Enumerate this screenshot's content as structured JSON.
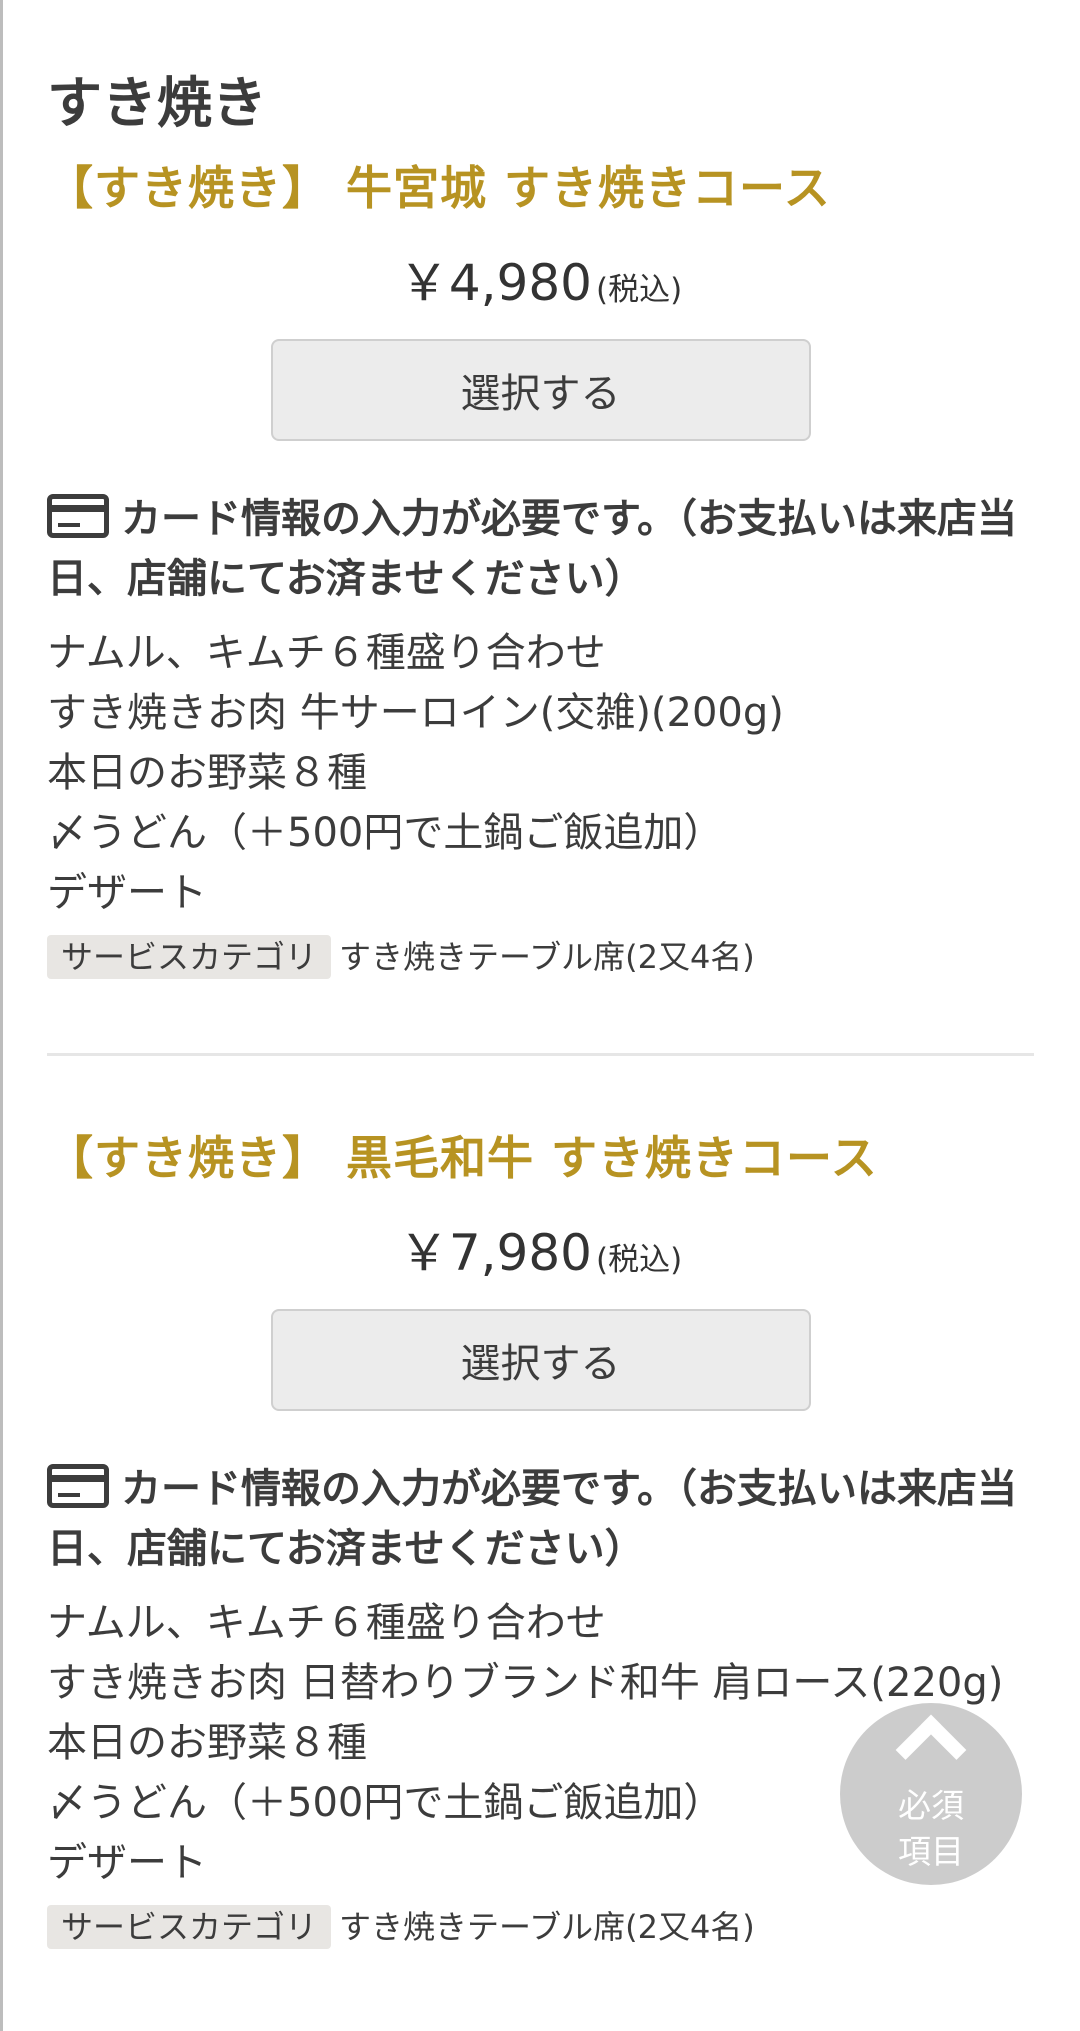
{
  "section": {
    "title": "すき焼き"
  },
  "courses": [
    {
      "title": "【すき焼き】 牛宮城 すき焼きコース",
      "price": "￥4,980",
      "tax_note": "(税込)",
      "select_label": "選択する",
      "card_notice": "カード情報の入力が必要です。（お支払いは来店当日、店舗にてお済ませください）",
      "menu": [
        "ナムル、キムチ６種盛り合わせ",
        "すき焼きお肉 牛サーロイン(交雑)(200g)",
        "本日のお野菜８種",
        "〆うどん（＋500円で土鍋ご飯追加）",
        "デザート"
      ],
      "category_label": "サービスカテゴリ",
      "category_value": "すき焼きテーブル席(2又4名)"
    },
    {
      "title": "【すき焼き】 黒毛和牛 すき焼きコース",
      "price": "￥7,980",
      "tax_note": "(税込)",
      "select_label": "選択する",
      "card_notice": "カード情報の入力が必要です。（お支払いは来店当日、店舗にてお済ませください）",
      "menu": [
        "ナムル、キムチ６種盛り合わせ",
        "すき焼きお肉 日替わりブランド和牛 肩ロース(220g)",
        "本日のお野菜８種",
        "〆うどん（＋500円で土鍋ご飯追加）",
        "デザート"
      ],
      "category_label": "サービスカテゴリ",
      "category_value": "すき焼きテーブル席(2又4名)"
    }
  ],
  "floating_button": {
    "icon": "chevron-up-icon",
    "label_line1": "必須",
    "label_line2": "項目"
  },
  "colors": {
    "accent_gold": "#b79322",
    "text": "#3c3c3c",
    "button_bg": "#ececec",
    "badge_bg": "#e8e6e3"
  }
}
